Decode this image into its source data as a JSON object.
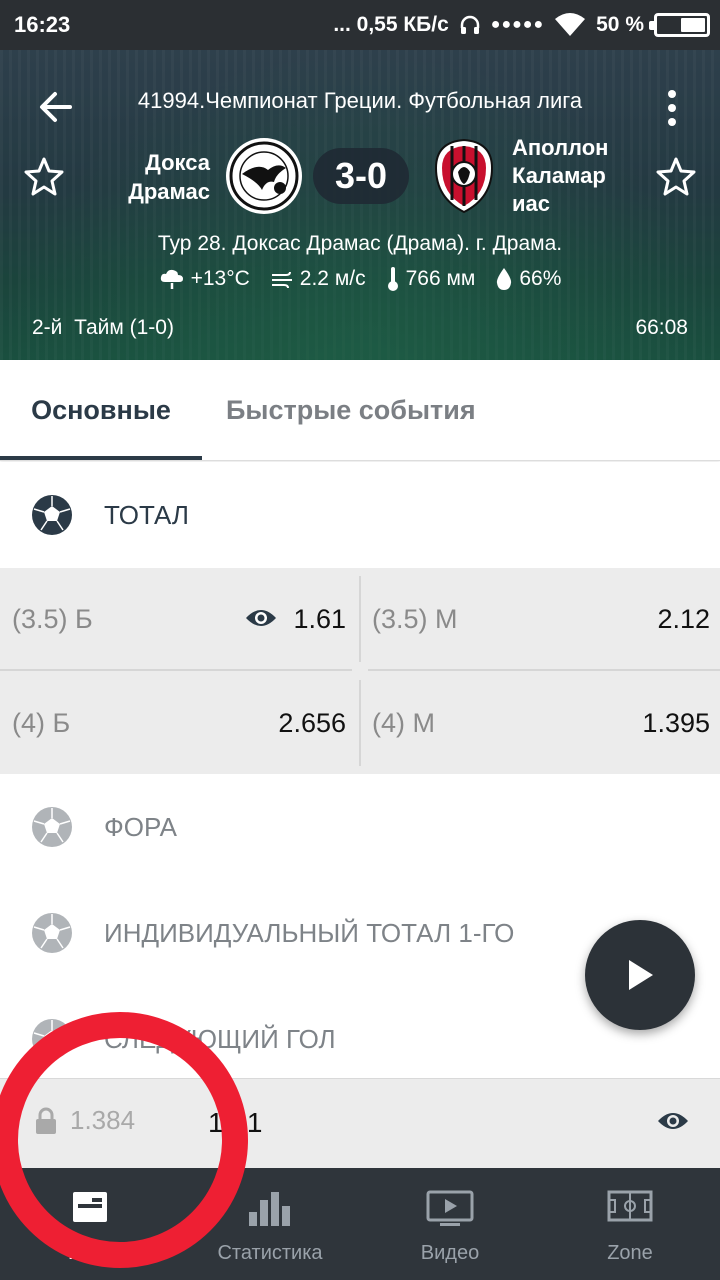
{
  "status_bar": {
    "time": "16:23",
    "network": "... 0,55 КБ/с",
    "signal": "●●●●●",
    "battery": "50 %",
    "battery_level": 0.5
  },
  "match": {
    "league": "41994.Чемпионат Греции. Футбольная лига",
    "team1": "Докса Драмас",
    "team2": "Аполлон Каламар иас",
    "score": "3-0",
    "venue": "Тур 28. Доксас Драмас (Драма). г. Драма.",
    "weather": {
      "temperature": "+13°C",
      "wind": "2.2 м/с",
      "pressure": "766 мм",
      "humidity": "66%"
    },
    "period": "2-й  Тайм (1-0)",
    "clock": "66:08"
  },
  "tabs": [
    {
      "label": "Основные",
      "active": true
    },
    {
      "label": "Быстрые события",
      "active": false
    }
  ],
  "markets": {
    "total": {
      "title": "ТОТАЛ",
      "odds": [
        {
          "label": "(3.5) Б",
          "value": "1.61"
        },
        {
          "label": "(3.5) М",
          "value": "2.12"
        },
        {
          "label": "(4) Б",
          "value": "2.656"
        },
        {
          "label": "(4) М",
          "value": "1.395"
        }
      ]
    },
    "handicap": {
      "title": "ФОРА"
    },
    "individual_total": {
      "title": "ИНДИВИДУАЛЬНЫЙ ТОТАЛ 1-ГО"
    },
    "next_goal": {
      "title": "СЛЕДУЮЩИЙ ГОЛ"
    }
  },
  "bet_bar": {
    "locked_value": "1.384",
    "value": "1.61"
  },
  "bottom_nav": [
    {
      "label": "Игра",
      "icon": "game-icon",
      "active": true
    },
    {
      "label": "Статистика",
      "icon": "statistics-icon",
      "active": false
    },
    {
      "label": "Видео",
      "icon": "video-icon",
      "active": false
    },
    {
      "label": "Zone",
      "icon": "zone-icon",
      "active": false
    }
  ],
  "colors": {
    "primary_dark": "#2b3a47",
    "annotation_red": "#ee1f33",
    "nav_background": "#2f353b"
  }
}
